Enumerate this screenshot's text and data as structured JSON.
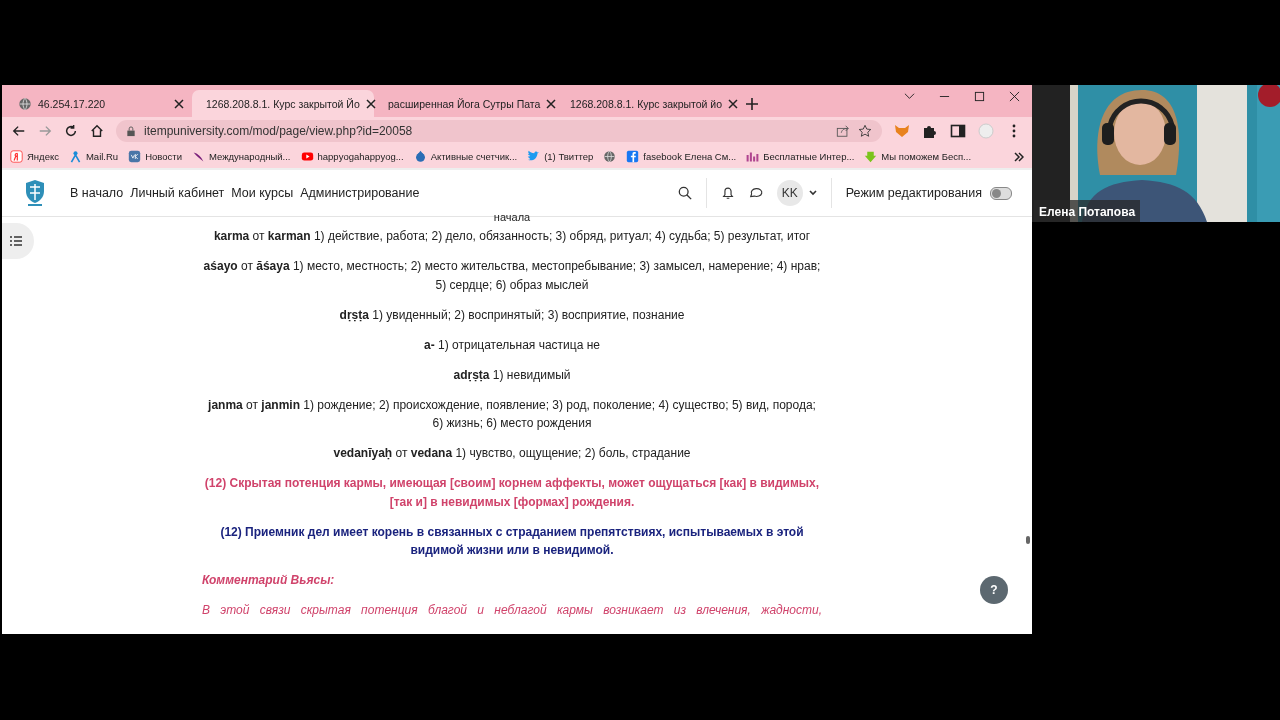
{
  "browser": {
    "tabs": [
      {
        "title": "46.254.17.220",
        "selected": false
      },
      {
        "title": "1268.208.8.1. Курс закрытой Йо",
        "selected": true
      },
      {
        "title": "расширенная Йога Сутры Пата",
        "selected": false
      },
      {
        "title": "1268.208.8.1. Курс закрытой йо",
        "selected": false
      }
    ],
    "address": "itempuniversity.com/mod/page/view.php?id=20058",
    "bookmarks": [
      {
        "label": "Яндекс"
      },
      {
        "label": "Mail.Ru"
      },
      {
        "label": "Новости"
      },
      {
        "label": "Международный..."
      },
      {
        "label": "happyogahappyog..."
      },
      {
        "label": "Активные счетчик..."
      },
      {
        "label": "(1) Твиттер"
      },
      {
        "kind": "icon_only"
      },
      {
        "label": "fasebook Елена См..."
      },
      {
        "label": "Бесплатные Интер..."
      },
      {
        "label": "Мы поможем Бесп..."
      }
    ]
  },
  "site": {
    "nav": [
      "В начало",
      "Личный кабинет",
      "Мои курсы",
      "Администрирование"
    ],
    "avatar": "KK",
    "edit_mode": {
      "label": "Режим редактирования",
      "on": false
    },
    "help": "?"
  },
  "content": [
    {
      "kind": "gloss",
      "text": "начала"
    },
    {
      "kind": "gloss",
      "text": "**karma** от **karman** 1) действие, работа; 2) дело, обязанность; 3) обряд, ритуал; 4) судьба; 5) результат, итог"
    },
    {
      "kind": "gloss",
      "text": "**aśayo** от **āśaya** 1) место, местность; 2) место жительства, местопребывание; 3) замысел, намерение; 4) нрав; 5) сердце; 6) образ мыслей"
    },
    {
      "kind": "gloss",
      "text": "**dṛṣṭa** 1) увиденный; 2) воспринятый; 3) восприятие, познание"
    },
    {
      "kind": "gloss",
      "text": "**a-** 1) отрицательная частица не"
    },
    {
      "kind": "gloss",
      "text": "**adṛṣṭa** 1) невидимый"
    },
    {
      "kind": "gloss",
      "text": "**janma** от **janmin** 1) рождение; 2) происхождение, появление; 3) род, поколение; 4) существо; 5) вид, порода; 6) жизнь; 6) место рождения"
    },
    {
      "kind": "gloss",
      "text": "**vedanīyaḥ** от **vedana** 1) чувство, ощущение; 2) боль, страдание"
    },
    {
      "kind": "sutra_pink",
      "text": "(12) Скрытая потенция кармы, имеющая [своим] корнем аффекты, может ощущаться [как] в видимых, [так и] в невидимых [формах] рождения."
    },
    {
      "kind": "sutra_blue",
      "text": "(12) Приемник дел имеет корень в связанных с страданием препятствиях, испытываемых в этой видимой жизни или в невидимой."
    },
    {
      "kind": "heading",
      "text": "Комментарий Вьясы:"
    },
    {
      "kind": "comment",
      "text": "В этой связи скрытая потенция благой и неблагой кармы возникает из влечения, жадности,"
    }
  ],
  "webcam": {
    "name": "Елена Потапова"
  }
}
